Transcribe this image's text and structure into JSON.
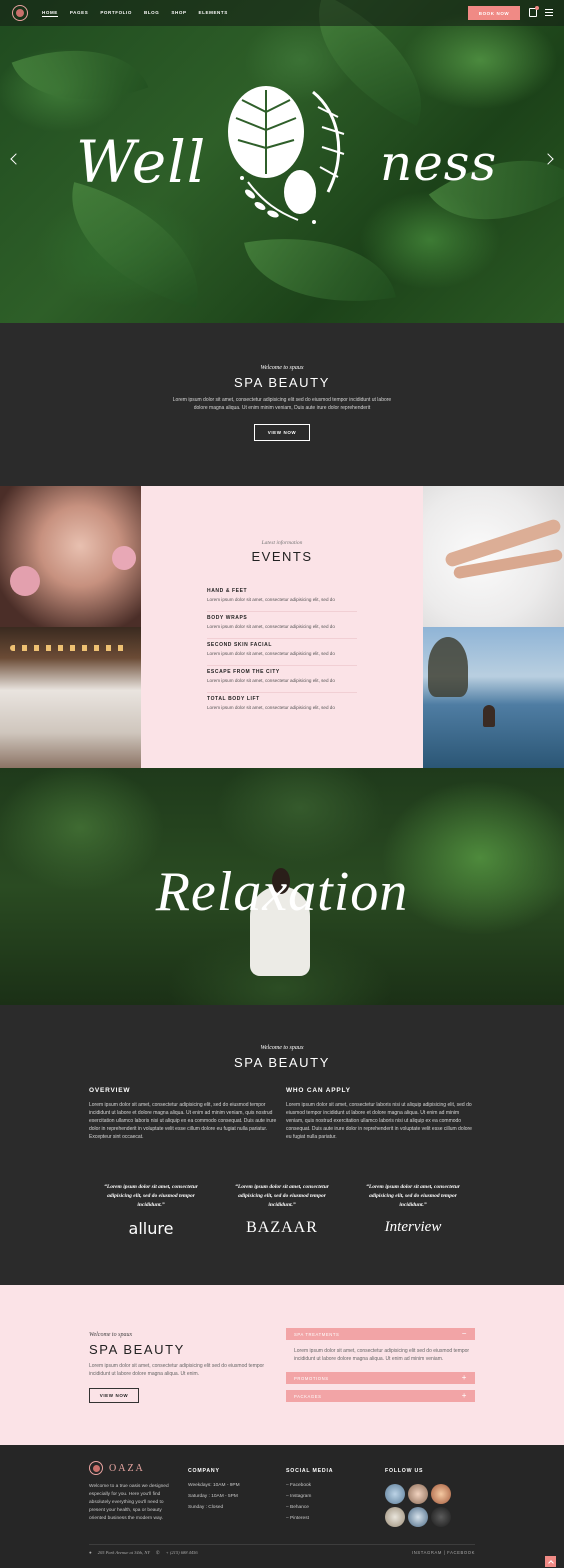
{
  "nav": {
    "items": [
      "HOME",
      "PAGES",
      "PORTFOLIO",
      "BLOG",
      "SHOP",
      "ELEMENTS"
    ],
    "book_label": "BOOK NOW",
    "icons": [
      "logo-icon",
      "cart-icon",
      "menu-icon"
    ]
  },
  "hero": {
    "word_left": "Well",
    "word_right": "ness"
  },
  "intro": {
    "kicker": "Welcome to spaux",
    "title": "SPA BEAUTY",
    "text1": "Lorem ipsum dolor sit amet, consectetur adipisicing elit sed do eiusmod tempor incididunt ut labore",
    "text2": "dolore magna aliqua. Ut enim minim veniam, Duis aute irure dolor reprehenderit",
    "button": "VIEW NOW"
  },
  "events": {
    "kicker": "Latest information",
    "title": "EVENTS",
    "items": [
      {
        "title": "HAND & FEET",
        "desc": "Lorem ipsum dolor sit amet, consectetur adipisicing elit, sed do"
      },
      {
        "title": "BODY WRAPS",
        "desc": "Lorem ipsum dolor sit amet, consectetur adipisicing elit, sed do"
      },
      {
        "title": "SECOND SKIN FACIAL",
        "desc": "Lorem ipsum dolor sit amet, consectetur adipisicing elit, sed do"
      },
      {
        "title": "ESCAPE FROM THE CITY",
        "desc": "Lorem ipsum dolor sit amet, consectetur adipisicing elit, sed do"
      },
      {
        "title": "TOTAL BODY LIFT",
        "desc": "Lorem ipsum dolor sit amet, consectetur adipisicing elit, sed do"
      }
    ]
  },
  "relax": {
    "word": "Relaxation"
  },
  "about": {
    "kicker": "Welcome to spaux",
    "title": "SPA BEAUTY",
    "overview_title": "OVERVIEW",
    "overview_text": "Lorem ipsum dolor sit amet, consectetur adipisicing elit, sed do eiusmod tempor incididunt ut labore et dolore magna aliqua. Ut enim ad minim veniam, quis nostrud exercitation ullamco laboris nisi ut aliquip ex ea commodo consequat. Duis aute irure dolor in reprehenderit in voluptate velit esse cillum dolore eu fugiat nulla pariatur. Excepteur sint occaecat.",
    "apply_title": "WHO CAN APPLY",
    "apply_text": "Lorem ipsum dolor sit amet, consectetur laboris nisi ut aliquip adipisicing elit, sed do eiusmod tempor incididunt ut labore et dolore magna aliqua. Ut enim ad minim veniam, quis nostrud exercitation ullamco laboris nisi ut aliquip ex ea commodo consequat. Duis aute irure dolor in reprehenderit in voluptate velit esse cillum dolore eu fugiat nulla pariatur."
  },
  "quotes": [
    {
      "text": "“Lorem ipsum dolor sit amet, consectetur adipisicing elit, sed do eiusmod tempor incididunt.”",
      "brand": "allure"
    },
    {
      "text": "“Lorem ipsum dolor sit amet, consectetur adipisicing elit, sed do eiusmod tempor incididunt.”",
      "brand": "BAZAAR"
    },
    {
      "text": "“Lorem ipsum dolor sit amet, consectetur adipisicing elit, sed do eiusmod tempor incididunt.”",
      "brand": "Interview"
    }
  ],
  "pink": {
    "kicker": "Welcome to spaux",
    "title": "SPA BEAUTY",
    "text": "Lorem ipsum dolor sit amet, consectetur adipisicing elit sed do eiusmod tempor incididunt ut labore dolore magna aliqua. Ut enim.",
    "button": "VIEW NOW",
    "accordion": [
      {
        "label": "SPA TREATMENTS",
        "open": true,
        "body": "Lorem ipsum dolor sit amet, consectetur adipisicing elit sed do eiusmod tempor incididunt ut labore dolore magna aliqua. Ut enim ad minim veniam."
      },
      {
        "label": "PROMOTIONS",
        "open": false
      },
      {
        "label": "PACKAGES",
        "open": false
      }
    ]
  },
  "footer": {
    "brand": "OAZA",
    "about": "Welcome to a true oasis we designed especially for you. Here you'll find absolutely everything you'll need to present your health, spa or beauty oriented business the modern way.",
    "company_title": "COMPANY",
    "company_lines": [
      "Weekdays: 10AM - 9PM",
      "Saturday : 10AM - 5PM",
      "Sunday : Closed"
    ],
    "social_title": "SOCIAL MEDIA",
    "social_links": [
      "– Facebook",
      "– Instagram",
      "– Behance",
      "– Pinterest"
    ],
    "follow_title": "FOLLOW US",
    "address": "205 Park Avenue at 34th, NY",
    "phone": "+ (215) 688 4456",
    "bottom_right": "INSTAGRAM | FACEBOOK"
  },
  "colors": {
    "accent": "#f08a85",
    "pink_bg": "#fbe3e7",
    "dark_bg": "#2b2b2b"
  }
}
